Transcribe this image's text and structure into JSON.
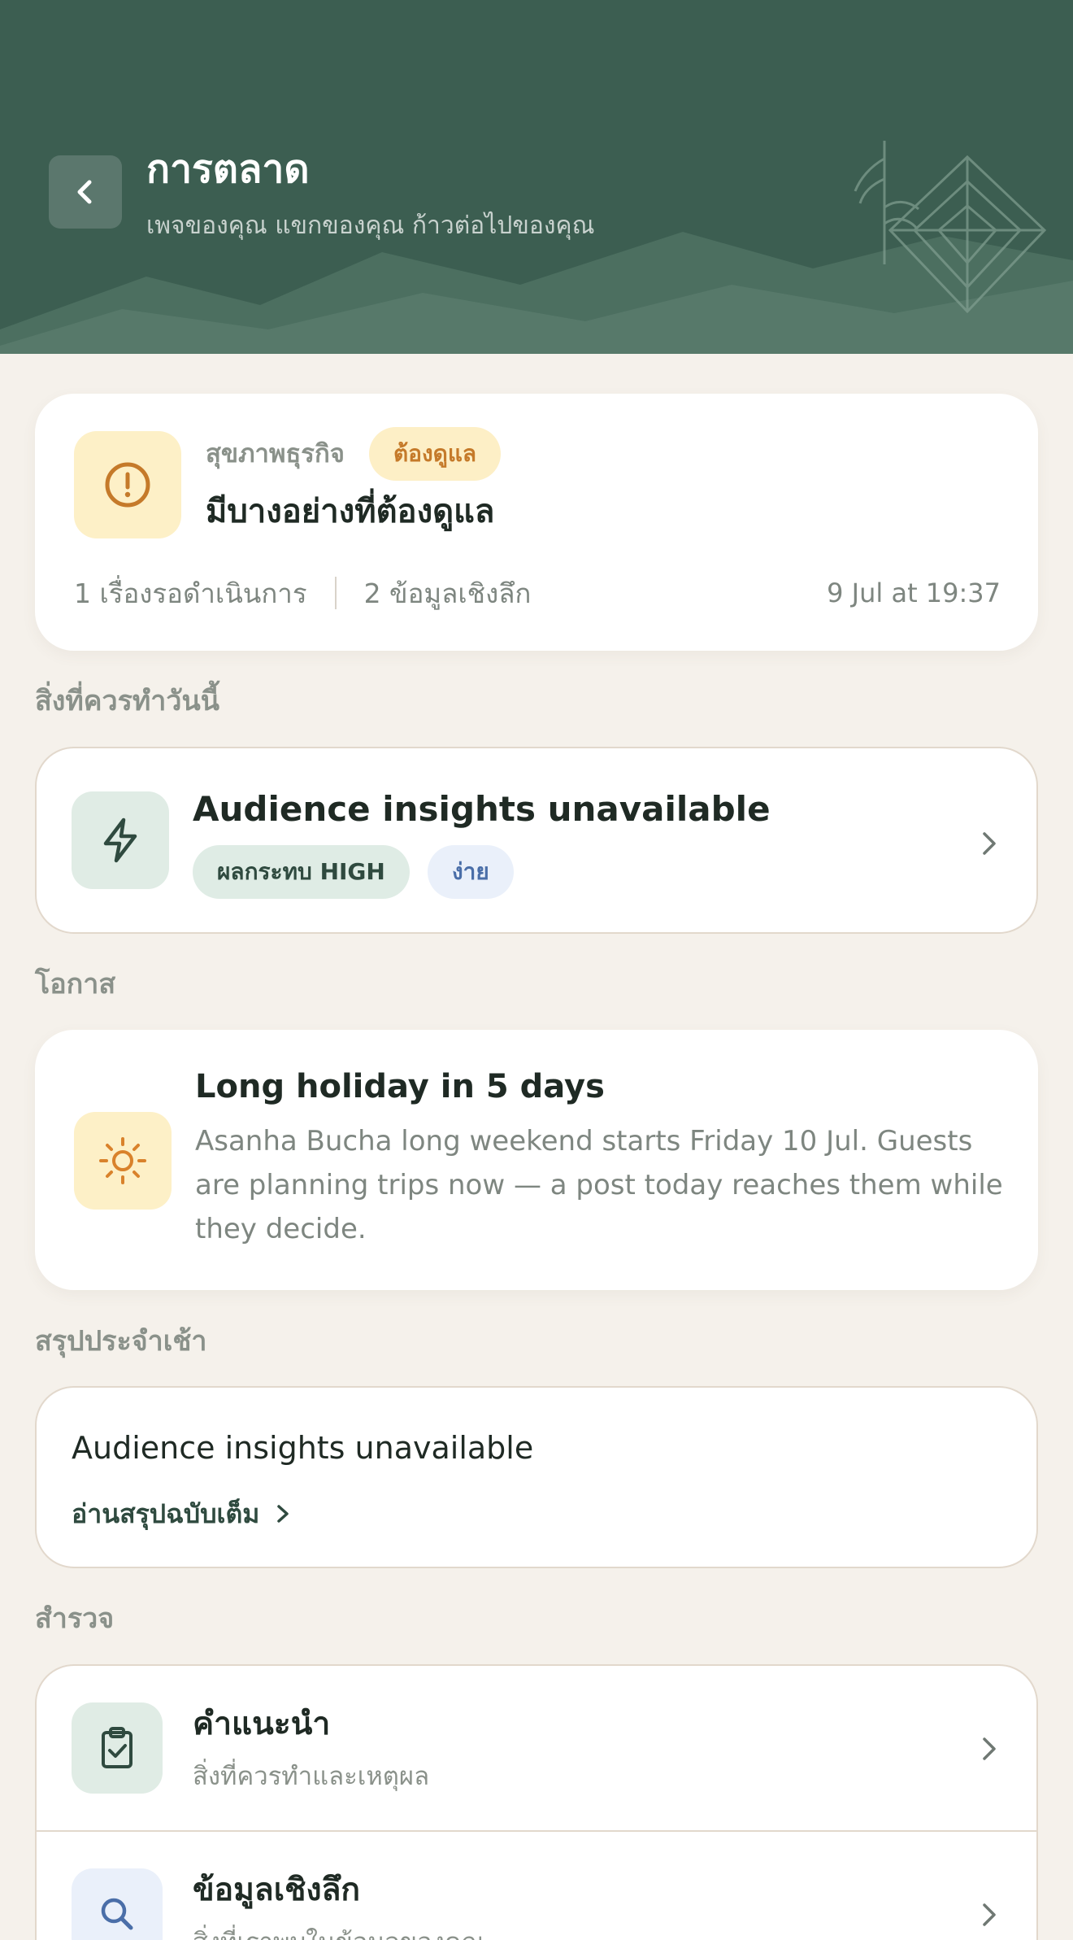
{
  "header": {
    "title": "การตลาด",
    "subtitle": "เพจของคุณ แขกของคุณ ก้าวต่อไปของคุณ"
  },
  "health": {
    "label": "สุขภาพธุรกิจ",
    "badge": "ต้องดูแล",
    "headline": "มีบางอย่างที่ต้องดูแล",
    "pending": "1 เรื่องรอดำเนินการ",
    "insights": "2 ข้อมูลเชิงลึก",
    "timestamp": "9 Jul at 19:37"
  },
  "sections": {
    "today": "สิ่งที่ควรทำวันนี้",
    "opportunity": "โอกาส",
    "summary": "สรุปประจำเช้า",
    "explore": "สำรวจ"
  },
  "today_item": {
    "title": "Audience insights unavailable",
    "tag_impact": "ผลกระทบ HIGH",
    "tag_effort": "ง่าย"
  },
  "opportunity": {
    "title": "Long holiday in 5 days",
    "description": "Asanha Bucha long weekend starts Friday 10 Jul. Guests are planning trips now — a post today reaches them while they decide."
  },
  "summary": {
    "text": "Audience insights unavailable",
    "link": "อ่านสรุปฉบับเต็ม"
  },
  "explore": [
    {
      "title": "คำแนะนำ",
      "subtitle": "สิ่งที่ควรทำและเหตุผล",
      "icon": "clipboard-check-icon"
    },
    {
      "title": "ข้อมูลเชิงลึก",
      "subtitle": "สิ่งที่เราพบในข้อมูลของคุณ",
      "icon": "search-icon"
    }
  ],
  "colors": {
    "header_bg": "#3c5e51",
    "page_bg": "#f5f1eb",
    "warning": "#c57a2a",
    "warning_bg": "#fdf0c7",
    "accent_green": "#2f4a3f"
  }
}
